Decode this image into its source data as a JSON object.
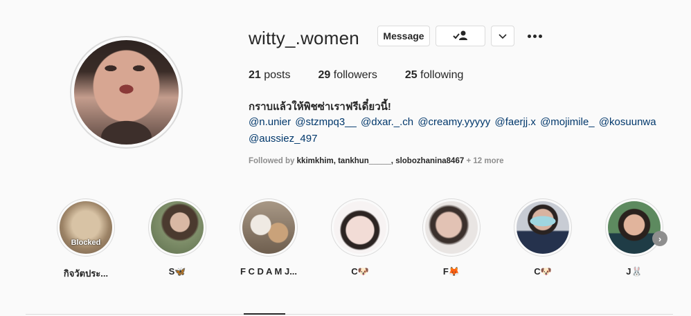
{
  "profile": {
    "username": "witty_.women",
    "message_label": "Message",
    "stats": {
      "posts_count": "21",
      "posts_label": "posts",
      "followers_count": "29",
      "followers_label": "followers",
      "following_count": "25",
      "following_label": "following"
    },
    "bio_name": "กราบแล้วให้พิชซ่าเราฟรีเดี๋ยวนี้!",
    "mentions_line1": [
      "@n.unier",
      "@stzmpq3__",
      "@dxar._.ch",
      "@creamy.yyyyy",
      "@faerjj.x",
      "@mojimile_",
      "@kosuunwa"
    ],
    "mentions_line2": [
      "@aussiez_497"
    ],
    "followed_by_prefix": "Followed by",
    "followed_by_names": "kkimkhim, tankhun_____, slobozhanina8467",
    "followed_by_more": "+ 12 more"
  },
  "highlights": [
    {
      "label": "กิจวัตประ...",
      "overlay": "Blocked",
      "color": "#b9a48a"
    },
    {
      "label": "S🦋",
      "color": "#7f8f6a"
    },
    {
      "label": "F C D A M J...",
      "color": "#8c7d6b"
    },
    {
      "label": "C🐶",
      "color": "#e9d6d2"
    },
    {
      "label": "F🦊",
      "color": "#cfc4c0"
    },
    {
      "label": "C🐶",
      "color": "#9aa6b8"
    },
    {
      "label": "J🐰",
      "color": "#4f7a5a"
    }
  ],
  "icons": {
    "follow_status": "person-check-icon",
    "chevron": "chevron-down-icon",
    "more": "more-options-icon",
    "next": "next-arrow-icon"
  }
}
